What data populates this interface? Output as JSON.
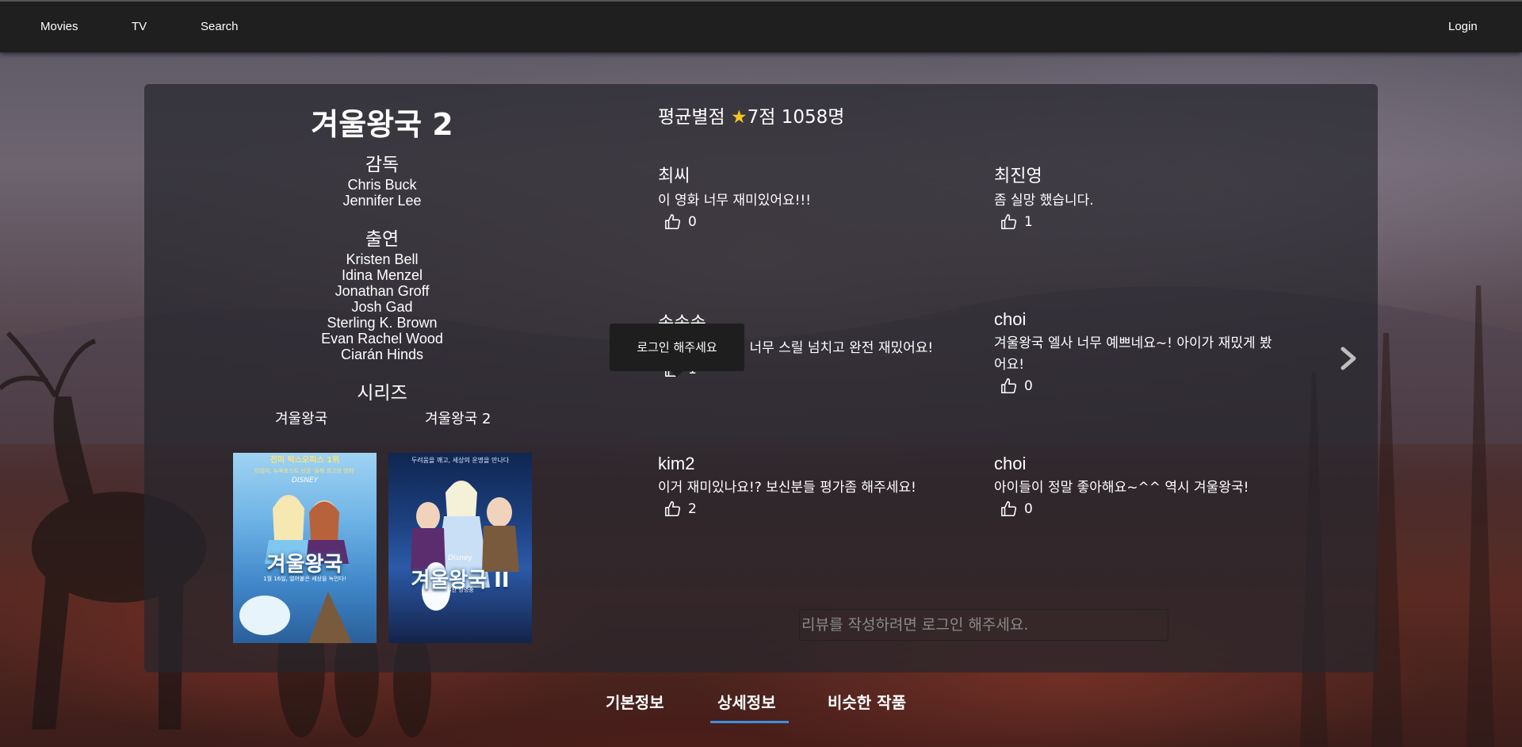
{
  "nav": {
    "movies": "Movies",
    "tv": "TV",
    "search": "Search",
    "login": "Login"
  },
  "movie": {
    "title": "겨울왕국 2",
    "director_heading": "감독",
    "directors": [
      "Chris Buck",
      "Jennifer Lee"
    ],
    "cast_heading": "출연",
    "cast": [
      "Kristen Bell",
      "Idina Menzel",
      "Jonathan Groff",
      "Josh Gad",
      "Sterling K. Brown",
      "Evan Rachel Wood",
      "Ciarán Hinds"
    ],
    "series_heading": "시리즈",
    "series": [
      "겨울왕국",
      "겨울왕국 2"
    ],
    "posters": [
      {
        "top_text": "전미 박스오피스 1위",
        "top_text_2": "타임지, 뉴욕포스트 선정 '올해 최고의 영화'",
        "brand": "DISNEY",
        "title": "겨울왕국",
        "subtitle": "1월 16일, 얼어붙은 세상을 녹인다!"
      },
      {
        "top_text": "두려움을 깨고, 세상의 운명을 만나다",
        "brand": "Disney",
        "title": "겨울왕국 II",
        "subtitle": "절찬 상영중"
      }
    ]
  },
  "rating": {
    "label": "평균별점",
    "star": "★",
    "score": "7점",
    "count": "1058명"
  },
  "reviews": [
    {
      "author": "최씨",
      "text": "이 영화 너무 재미있어요!!!",
      "likes": "0"
    },
    {
      "author": "최진영",
      "text": "좀 실망 했습니다.",
      "likes": "1"
    },
    {
      "author": "송송송",
      "text": "완전 추천 추~! 너무 스릴 넘치고 완전 재밌어요!",
      "likes": "1"
    },
    {
      "author": "choi",
      "text": "겨울왕국 엘사 너무 예쁘네요~! 아이가 재밌게 봤어요!",
      "likes": "0"
    },
    {
      "author": "kim2",
      "text": "이거 재미있나요!? 보신분들 평가좀 해주세요!",
      "likes": "2"
    },
    {
      "author": "choi",
      "text": "아이들이 정말 좋아해요~^^ 역시 겨울왕국!",
      "likes": "0"
    }
  ],
  "tooltip": "로그인 해주세요",
  "review_input": {
    "placeholder": "리뷰를 작성하려면 로그인 해주세요."
  },
  "tabs": {
    "basic": "기본정보",
    "detail": "상세정보",
    "similar": "비슷한 작품",
    "active": "상세정보"
  },
  "colors": {
    "accent": "#3d8fe0",
    "star": "#f3c623",
    "nav_bg": "#1f1f1f"
  }
}
